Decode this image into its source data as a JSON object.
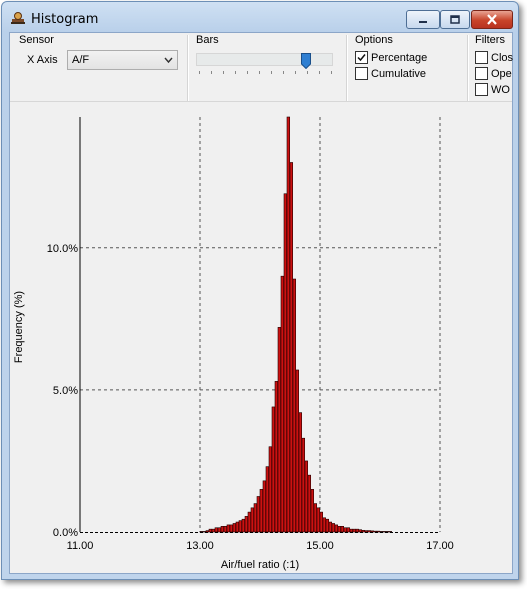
{
  "window": {
    "title": "Histogram"
  },
  "sensor": {
    "group_label": "Sensor",
    "x_axis_label": "X Axis",
    "x_axis_value": "A/F"
  },
  "bars": {
    "group_label": "Bars"
  },
  "options": {
    "group_label": "Options",
    "percentage_label": "Percentage",
    "percentage_checked": true,
    "cumulative_label": "Cumulative",
    "cumulative_checked": false
  },
  "filters": {
    "group_label": "Filters",
    "closed_label": "Clos",
    "open_label": "Ope",
    "wot_label": "WO"
  },
  "colors": {
    "bar_fill": "#cc1111",
    "bar_stroke": "#200000",
    "title_bar": "#c9dcf1",
    "close_button": "#c8442a"
  },
  "chart_data": {
    "type": "bar",
    "xlabel": "Air/fuel ratio (:1)",
    "ylabel": "Frequency (%)",
    "xlim": [
      11.0,
      17.0
    ],
    "ylim": [
      0,
      14.6
    ],
    "xticks": [
      "11.00",
      "13.00",
      "15.00",
      "17.00"
    ],
    "yticks": [
      "0.0%",
      "5.0%",
      "10.0%"
    ],
    "grid": true,
    "bin_width": 0.05,
    "x": [
      13.0,
      13.05,
      13.1,
      13.15,
      13.2,
      13.25,
      13.3,
      13.35,
      13.4,
      13.45,
      13.5,
      13.55,
      13.6,
      13.65,
      13.7,
      13.75,
      13.8,
      13.85,
      13.9,
      13.95,
      14.0,
      14.05,
      14.1,
      14.15,
      14.2,
      14.25,
      14.3,
      14.35,
      14.4,
      14.45,
      14.5,
      14.55,
      14.6,
      14.65,
      14.7,
      14.75,
      14.8,
      14.85,
      14.9,
      14.95,
      15.0,
      15.05,
      15.1,
      15.15,
      15.2,
      15.25,
      15.3,
      15.35,
      15.4,
      15.45,
      15.5,
      15.55,
      15.6,
      15.65,
      15.7,
      15.75,
      15.8,
      15.85,
      15.9,
      15.95,
      16.0,
      16.05,
      16.1,
      16.15
    ],
    "values": [
      0.02,
      0.02,
      0.05,
      0.1,
      0.1,
      0.15,
      0.15,
      0.2,
      0.2,
      0.25,
      0.25,
      0.3,
      0.35,
      0.4,
      0.45,
      0.55,
      0.7,
      0.85,
      1.0,
      1.25,
      1.5,
      1.8,
      2.3,
      3.0,
      4.4,
      5.3,
      7.2,
      9.0,
      11.9,
      14.6,
      13.0,
      8.9,
      5.7,
      4.2,
      3.3,
      2.5,
      2.0,
      1.5,
      1.0,
      0.85,
      0.7,
      0.5,
      0.45,
      0.35,
      0.3,
      0.25,
      0.2,
      0.2,
      0.15,
      0.15,
      0.1,
      0.1,
      0.1,
      0.08,
      0.06,
      0.05,
      0.05,
      0.04,
      0.03,
      0.03,
      0.02,
      0.02,
      0.02,
      0.02
    ]
  }
}
